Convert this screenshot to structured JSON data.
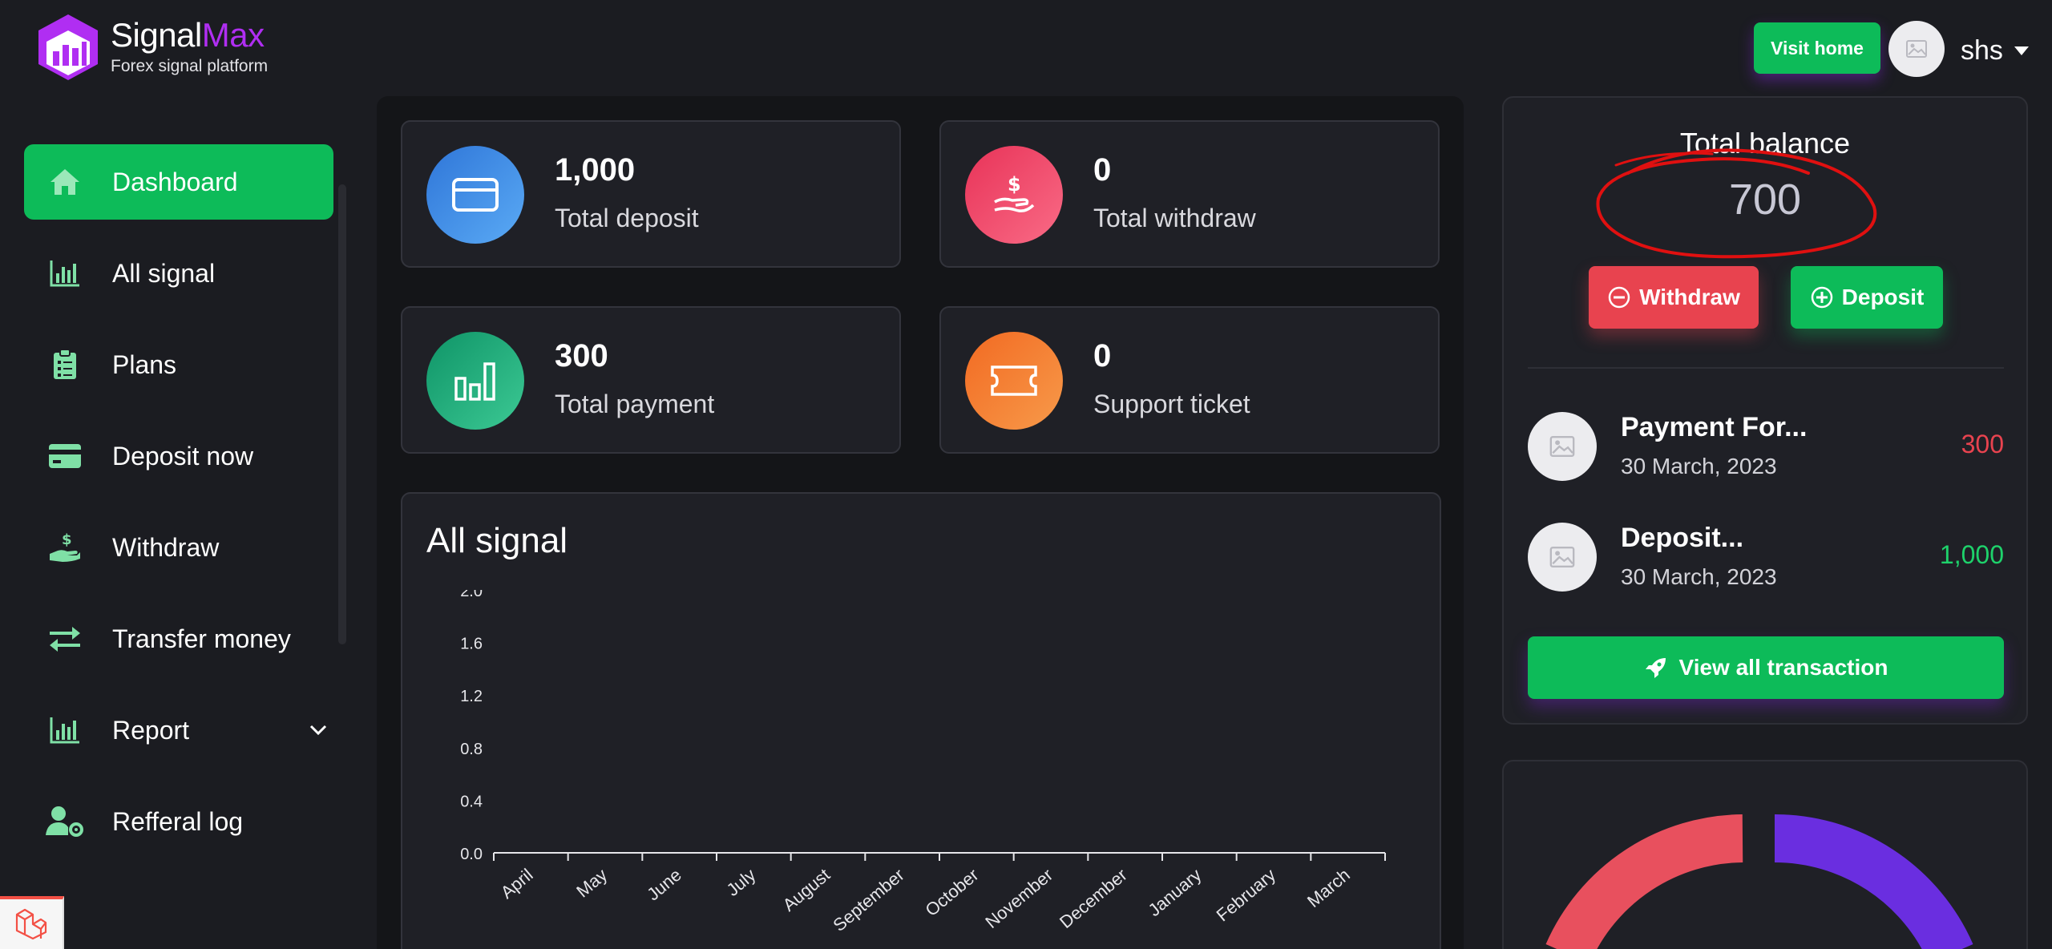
{
  "brand": {
    "name_part1": "Signal",
    "name_part2": "Max",
    "tagline": "Forex signal platform"
  },
  "header": {
    "visit_home_label": "Visit home",
    "user_name": "shs"
  },
  "sidebar": {
    "items": [
      {
        "label": "Dashboard",
        "icon": "home-icon",
        "active": true
      },
      {
        "label": "All signal",
        "icon": "bar-chart-icon"
      },
      {
        "label": "Plans",
        "icon": "clipboard-list-icon"
      },
      {
        "label": "Deposit now",
        "icon": "credit-card-icon"
      },
      {
        "label": "Withdraw",
        "icon": "hand-dollar-icon"
      },
      {
        "label": "Transfer money",
        "icon": "transfer-arrows-icon"
      },
      {
        "label": "Report",
        "icon": "bar-chart-icon",
        "has_submenu": true
      },
      {
        "label": "Refferal log",
        "icon": "user-gear-icon"
      }
    ]
  },
  "stats": [
    {
      "value": "1,000",
      "label": "Total deposit",
      "icon": "card-icon",
      "color": "#3b82e6"
    },
    {
      "value": "0",
      "label": "Total withdraw",
      "icon": "hand-dollar-icon",
      "color": "#ef3f63"
    },
    {
      "value": "300",
      "label": "Total payment",
      "icon": "bar-chart-icon",
      "color": "#17a57a"
    },
    {
      "value": "0",
      "label": "Support ticket",
      "icon": "ticket-icon",
      "color": "#f47a2d"
    }
  ],
  "signal_panel": {
    "title": "All signal"
  },
  "chart_data": {
    "type": "bar",
    "title": "",
    "categories": [
      "April",
      "May",
      "June",
      "July",
      "August",
      "September",
      "October",
      "November",
      "December",
      "January",
      "February",
      "March"
    ],
    "series": [
      {
        "values": [
          0,
          0,
          0,
          0,
          0,
          0,
          0,
          0,
          0,
          0,
          0,
          0
        ]
      }
    ],
    "y_ticks": [
      "0.0",
      "0.4",
      "0.8",
      "1.2",
      "1.6",
      "2.0"
    ],
    "ylim": [
      0,
      2
    ],
    "grid": false
  },
  "balance": {
    "title": "Total balance",
    "value": "700",
    "withdraw_label": "Withdraw",
    "deposit_label": "Deposit"
  },
  "transactions": [
    {
      "title": "Payment For...",
      "date": "30 March, 2023",
      "amount": "300",
      "color": "#e8434f"
    },
    {
      "title": "Deposit...",
      "date": "30 March, 2023",
      "amount": "1,000",
      "color": "#1ed26b"
    }
  ],
  "view_all_label": "View all transaction",
  "colors": {
    "accent_green": "#0dbb59",
    "brand_purple": "#b02ef2",
    "danger_red": "#e8434f",
    "annotation_red": "#e01010",
    "donut_red": "#e8505e",
    "donut_purple": "#6a2ee0"
  }
}
